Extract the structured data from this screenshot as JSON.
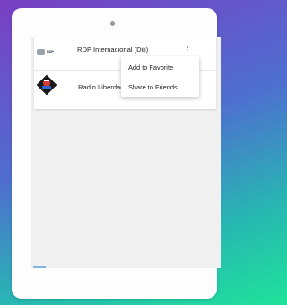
{
  "stations": [
    {
      "name": "RDP Internacional (Dili)",
      "logo_text": "RDP"
    },
    {
      "name": "Radio Liberdade Dili",
      "logo_text": ""
    }
  ],
  "context_menu": {
    "items": [
      "Add to Favorite",
      "Share to Friends"
    ]
  },
  "colors": {
    "background_top": "#7a3fc4",
    "background_bottom": "#1fe39a",
    "device": "#fdfdfd",
    "screen": "#f0f0f0"
  }
}
